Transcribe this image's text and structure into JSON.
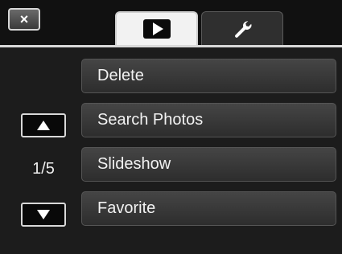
{
  "header": {
    "close_symbol": "×",
    "tabs": [
      {
        "id": "playback",
        "icon": "play-icon",
        "active": true
      },
      {
        "id": "setup",
        "icon": "wrench-icon",
        "active": false
      }
    ]
  },
  "menu": {
    "items": [
      {
        "label": "Delete"
      },
      {
        "label": "Search Photos"
      },
      {
        "label": "Slideshow"
      },
      {
        "label": "Favorite"
      }
    ]
  },
  "pager": {
    "indicator": "1/5",
    "up_icon": "arrow-up-icon",
    "down_icon": "arrow-down-icon"
  },
  "colors": {
    "background": "#1c1c1c",
    "menu_button": "#3a3a3a",
    "active_tab": "#f2f2f2",
    "divider": "#d9d9d9"
  }
}
